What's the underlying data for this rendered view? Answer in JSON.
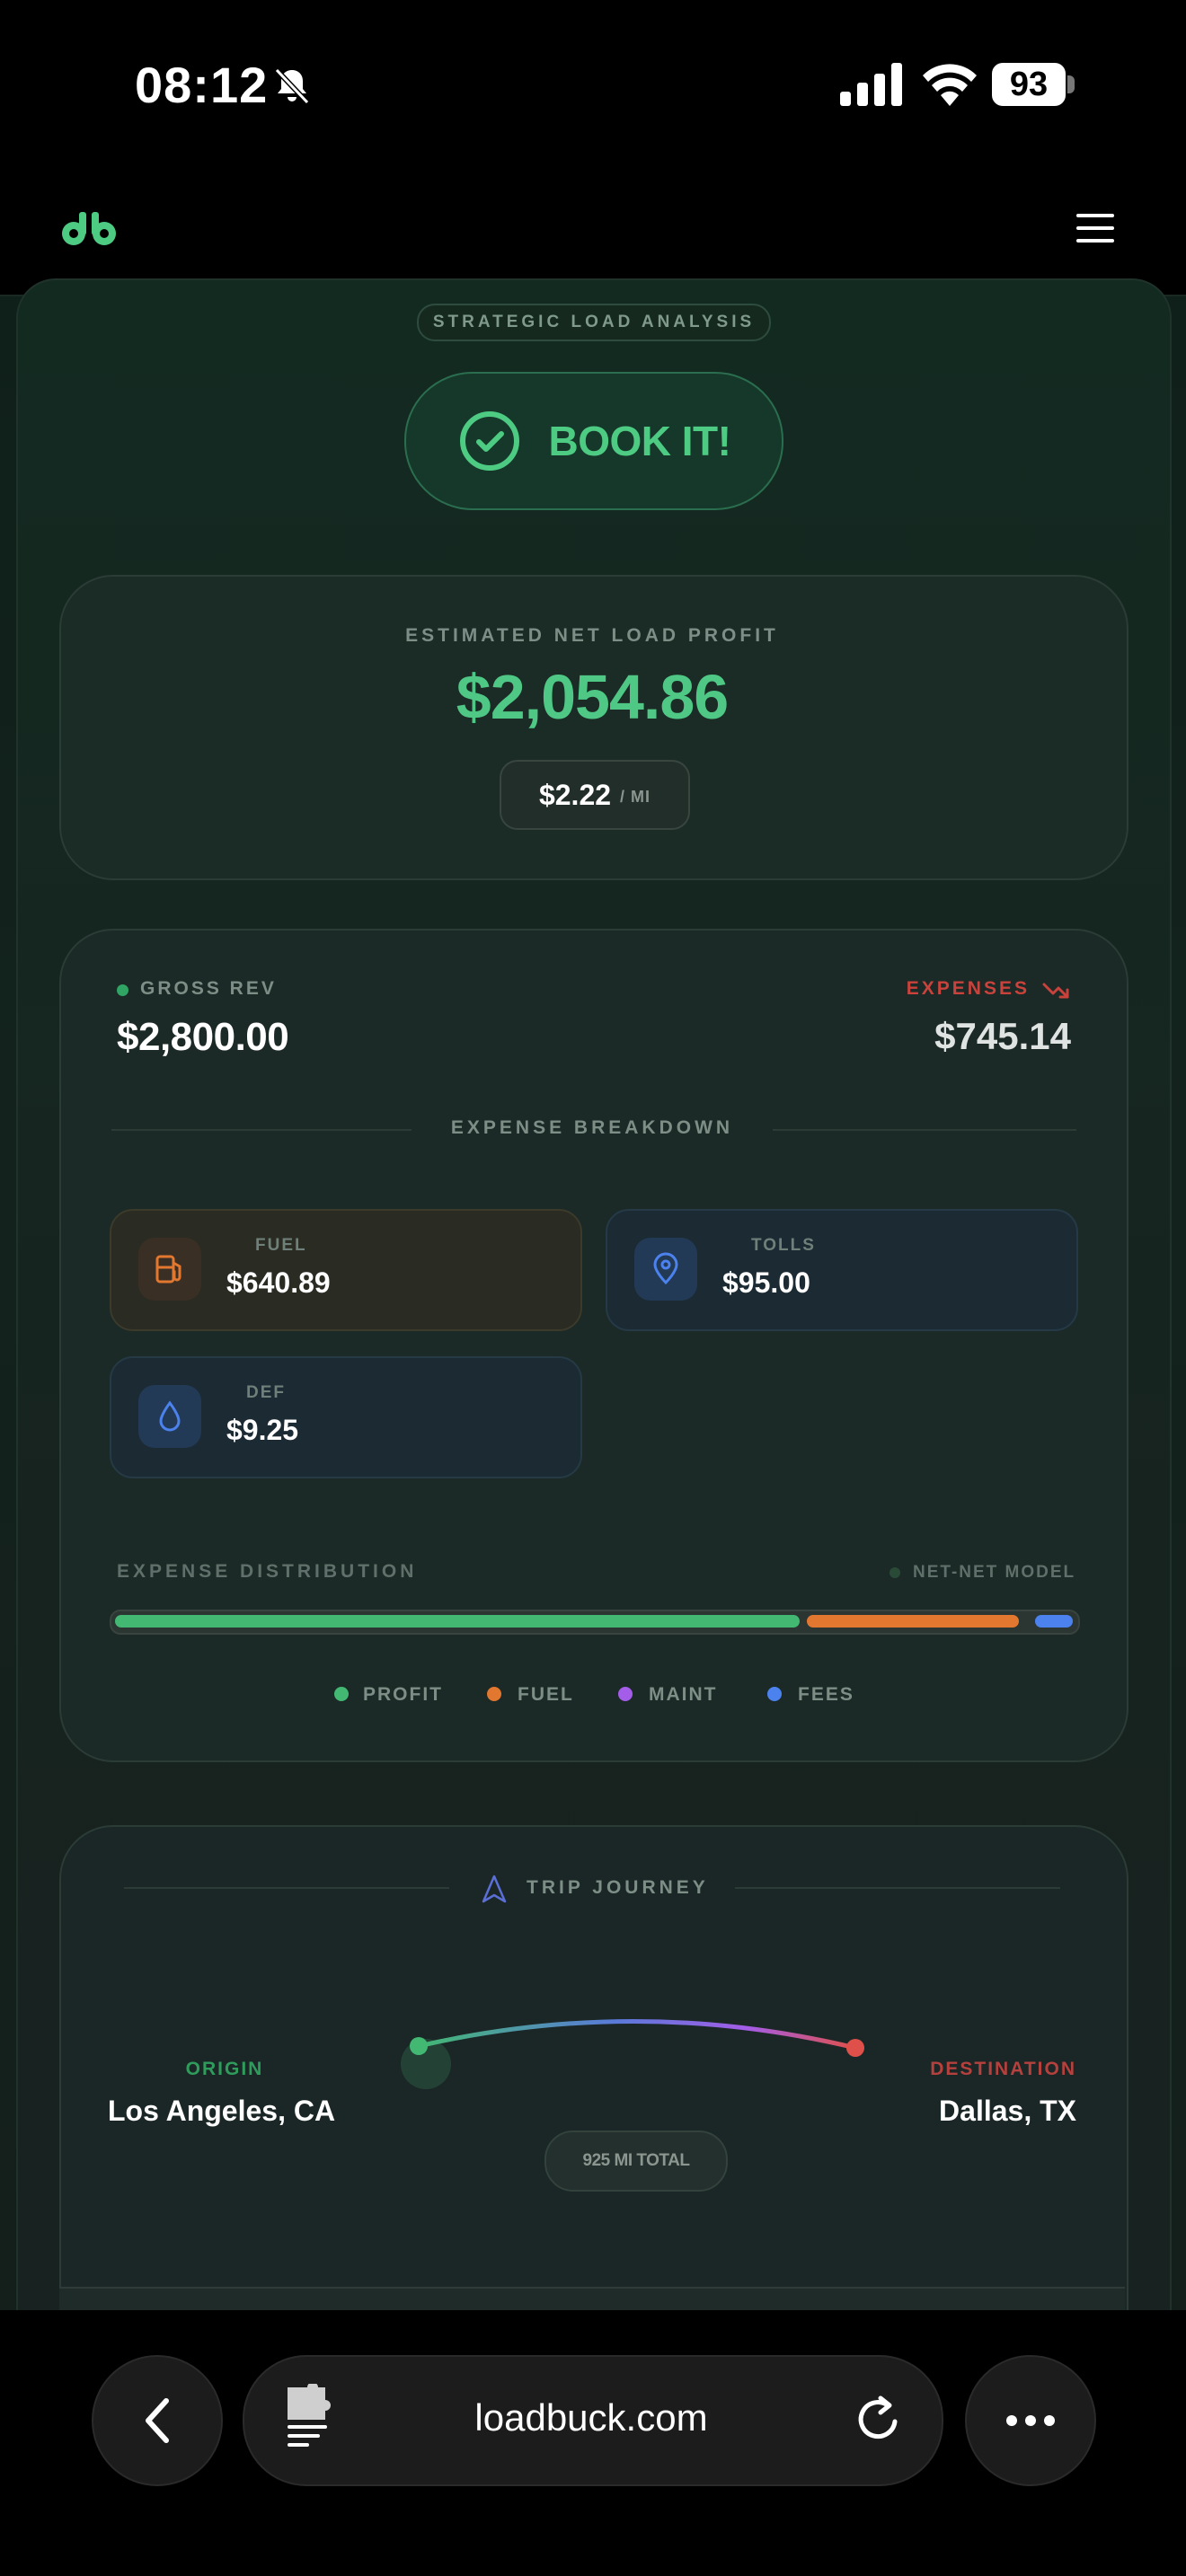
{
  "status": {
    "time": "08:12",
    "battery": "93"
  },
  "browser": {
    "url": "loadbuck.com"
  },
  "analysis": {
    "pill": "STRATEGIC LOAD ANALYSIS",
    "book_label": "BOOK IT!"
  },
  "profit": {
    "label": "ESTIMATED NET LOAD PROFIT",
    "value": "$2,054.86",
    "per_mile_value": "$2.22",
    "per_mile_unit": "/ MI"
  },
  "breakdown": {
    "gross_label": "GROSS REV",
    "gross_value": "$2,800.00",
    "expenses_label": "EXPENSES",
    "expenses_value": "$745.14",
    "title": "EXPENSE BREAKDOWN",
    "tiles": [
      {
        "label": "FUEL",
        "value": "$640.89",
        "icon": "fuel-pump-icon",
        "color": "#e2772f"
      },
      {
        "label": "TOLLS",
        "value": "$95.00",
        "icon": "map-pin-icon",
        "color": "#4c82ee"
      },
      {
        "label": "DEF",
        "value": "$9.25",
        "icon": "droplet-icon",
        "color": "#4c82ee"
      }
    ]
  },
  "distribution": {
    "label": "EXPENSE DISTRIBUTION",
    "model": "NET-NET MODEL",
    "shares": {
      "profit": 0.733,
      "fuel": 0.229,
      "fees": 0.038
    },
    "legend": [
      {
        "label": "PROFIT",
        "color": "#43b873"
      },
      {
        "label": "FUEL",
        "color": "#e2772f"
      },
      {
        "label": "MAINT",
        "color": "#a35de8"
      },
      {
        "label": "FEES",
        "color": "#4c82ee"
      }
    ]
  },
  "journey": {
    "title": "TRIP JOURNEY",
    "origin_label": "ORIGIN",
    "origin": "Los Angeles, CA",
    "destination_label": "DESTINATION",
    "destination": "Dallas, TX",
    "total": "925 MI TOTAL"
  },
  "colors": {
    "accent_green": "#4ecb82",
    "expense_red": "#c9423b"
  }
}
